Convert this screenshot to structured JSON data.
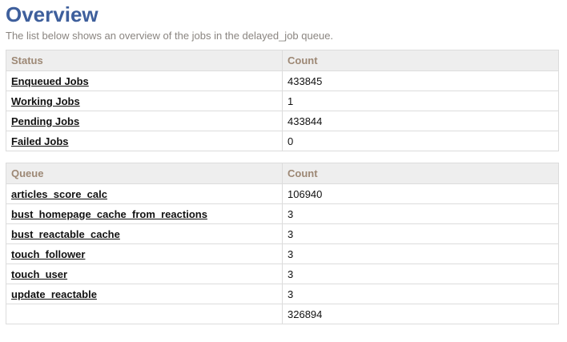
{
  "title": "Overview",
  "intro": "The list below shows an overview of the jobs in the delayed_job queue.",
  "status_table": {
    "headers": [
      "Status",
      "Count"
    ],
    "rows": [
      {
        "label": "Enqueued Jobs",
        "count": "433845"
      },
      {
        "label": "Working Jobs",
        "count": "1"
      },
      {
        "label": "Pending Jobs",
        "count": "433844"
      },
      {
        "label": "Failed Jobs",
        "count": "0"
      }
    ]
  },
  "queue_table": {
    "headers": [
      "Queue",
      "Count"
    ],
    "rows": [
      {
        "label": "articles_score_calc",
        "count": "106940"
      },
      {
        "label": "bust_homepage_cache_from_reactions",
        "count": "3"
      },
      {
        "label": "bust_reactable_cache",
        "count": "3"
      },
      {
        "label": "touch_follower",
        "count": "3"
      },
      {
        "label": "touch_user",
        "count": "3"
      },
      {
        "label": "update_reactable",
        "count": "3"
      }
    ],
    "total": "326894"
  }
}
